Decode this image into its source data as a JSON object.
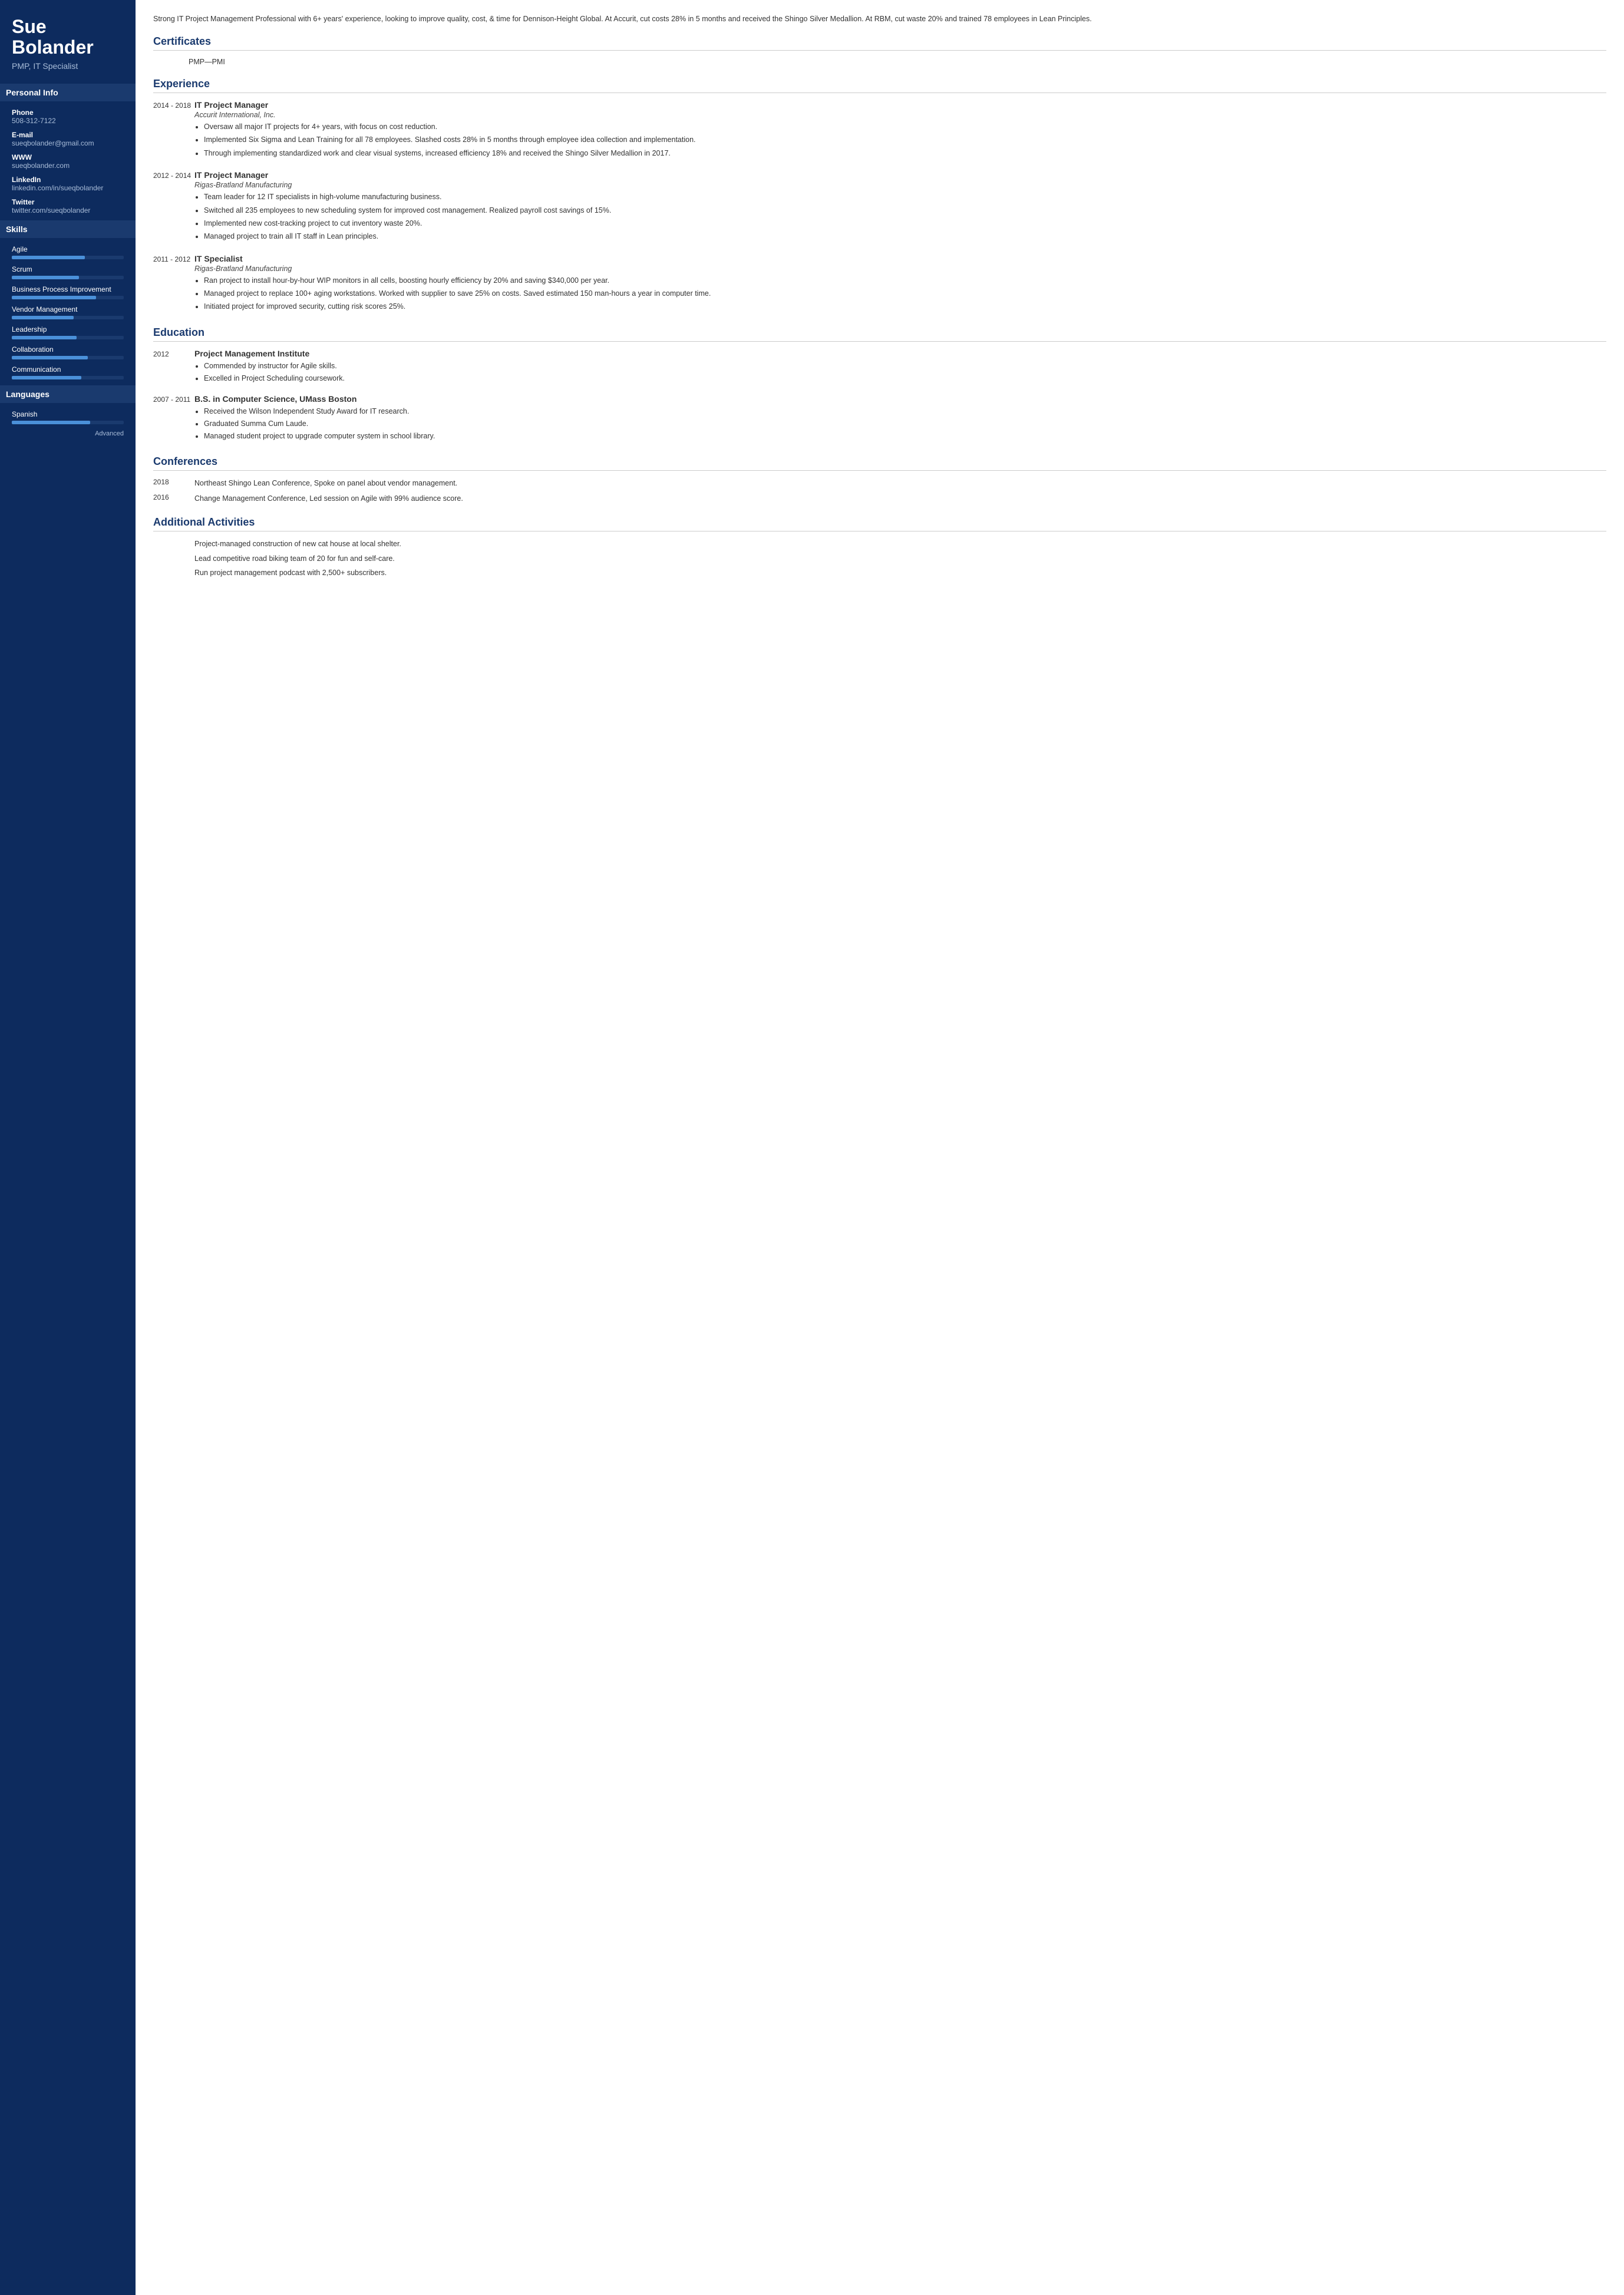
{
  "sidebar": {
    "name": "Sue Bolander",
    "title": "PMP, IT Specialist",
    "personal_info_label": "Personal Info",
    "contacts": [
      {
        "label": "Phone",
        "value": "508-312-7122"
      },
      {
        "label": "E-mail",
        "value": "sueqbolander@gmail.com"
      },
      {
        "label": "WWW",
        "value": "sueqbolander.com"
      },
      {
        "label": "LinkedIn",
        "value": "linkedin.com/in/sueqbolander"
      },
      {
        "label": "Twitter",
        "value": "twitter.com/sueqbolander"
      }
    ],
    "skills_label": "Skills",
    "skills": [
      {
        "name": "Agile",
        "pct": 65
      },
      {
        "name": "Scrum",
        "pct": 60
      },
      {
        "name": "Business Process Improvement",
        "pct": 75
      },
      {
        "name": "Vendor Management",
        "pct": 55
      },
      {
        "name": "Leadership",
        "pct": 58
      },
      {
        "name": "Collaboration",
        "pct": 68
      },
      {
        "name": "Communication",
        "pct": 62
      }
    ],
    "languages_label": "Languages",
    "languages": [
      {
        "name": "Spanish",
        "pct": 70,
        "level": "Advanced"
      }
    ]
  },
  "main": {
    "summary": "Strong IT Project Management Professional with 6+ years' experience, looking to improve quality, cost, & time for Dennison-Height Global. At Accurit, cut costs 28% in 5 months and received the Shingo Silver Medallion. At RBM, cut waste 20% and trained 78 employees in Lean Principles.",
    "certificates_label": "Certificates",
    "certificates": [
      "PMP—PMI"
    ],
    "experience_label": "Experience",
    "experience": [
      {
        "dates": "2014 - 2018",
        "title": "IT Project Manager",
        "company": "Accurit International, Inc.",
        "bullets": [
          "Oversaw all major IT projects for 4+ years, with focus on cost reduction.",
          "Implemented Six Sigma and Lean Training for all 78 employees. Slashed costs 28% in 5 months through employee idea collection and implementation.",
          "Through implementing standardized work and clear visual systems, increased efficiency 18% and received the Shingo Silver Medallion in 2017."
        ]
      },
      {
        "dates": "2012 - 2014",
        "title": "IT Project Manager",
        "company": "Rigas-Bratland Manufacturing",
        "bullets": [
          "Team leader for 12 IT specialists in high-volume manufacturing business.",
          "Switched all 235 employees to new scheduling system for improved cost management. Realized payroll cost savings of 15%.",
          "Implemented new cost-tracking project to cut inventory waste 20%.",
          "Managed project to train all IT staff in Lean principles."
        ]
      },
      {
        "dates": "2011 - 2012",
        "title": "IT Specialist",
        "company": "Rigas-Bratland Manufacturing",
        "bullets": [
          "Ran project to install hour-by-hour WIP monitors in all cells, boosting hourly efficiency by 20% and saving $340,000 per year.",
          "Managed project to replace 100+ aging workstations. Worked with supplier to save 25% on costs. Saved estimated 150 man-hours a year in computer time.",
          "Initiated project for improved security, cutting risk scores 25%."
        ]
      }
    ],
    "education_label": "Education",
    "education": [
      {
        "year": "2012",
        "institution": "Project Management Institute",
        "bullets": [
          "Commended by instructor for Agile skills.",
          "Excelled in Project Scheduling coursework."
        ]
      },
      {
        "year": "2007 - 2011",
        "institution": "B.S. in Computer Science, UMass Boston",
        "bullets": [
          "Received the Wilson Independent Study Award for IT research.",
          "Graduated Summa Cum Laude.",
          "Managed student project to upgrade computer system in school library."
        ]
      }
    ],
    "conferences_label": "Conferences",
    "conferences": [
      {
        "year": "2018",
        "text": "Northeast Shingo Lean Conference, Spoke on panel about vendor management."
      },
      {
        "year": "2016",
        "text": "Change Management Conference, Led session on Agile with 99% audience score."
      }
    ],
    "activities_label": "Additional Activities",
    "activities": [
      "Project-managed construction of new cat house at local shelter.",
      "Lead competitive road biking team of 20 for fun and self-care.",
      "Run project management podcast with 2,500+ subscribers."
    ]
  }
}
